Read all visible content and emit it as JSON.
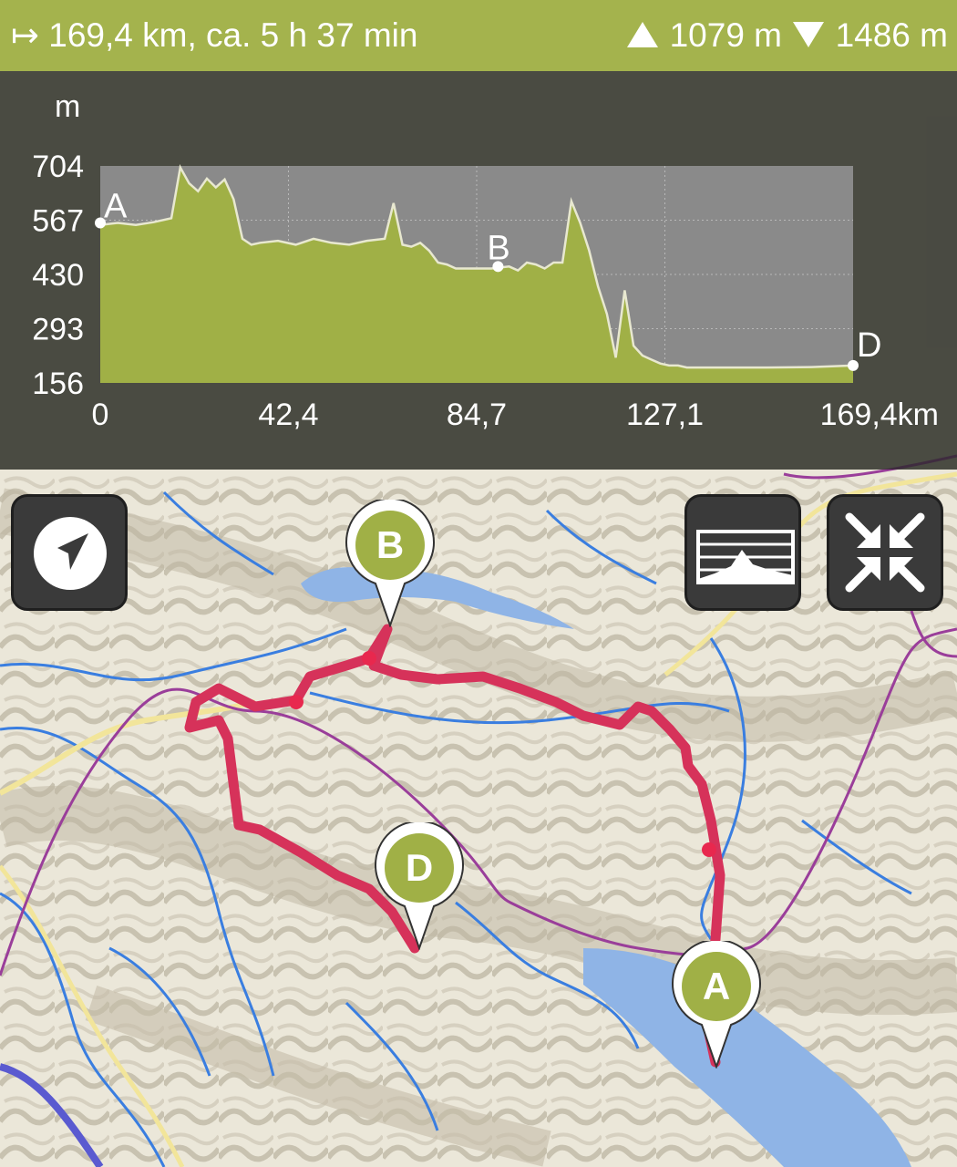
{
  "stats": {
    "distance_time": "↦ 169,4 km, ca. 5 h 37 min",
    "ascent": "1079 m",
    "descent": "1486 m"
  },
  "elevation_profile": {
    "unit": "m",
    "y_ticks": [
      "704",
      "567",
      "430",
      "293",
      "156"
    ],
    "x_ticks": [
      "0",
      "42,4",
      "84,7",
      "127,1",
      "169,4km"
    ],
    "waypoint_labels": [
      "A",
      "B",
      "D"
    ],
    "chart_data": {
      "type": "area",
      "ylim": [
        156,
        704
      ],
      "xlim": [
        0,
        169.4
      ],
      "x": [
        0,
        4,
        8,
        12,
        16,
        18,
        20,
        22,
        24,
        26,
        28,
        30,
        32,
        34,
        36,
        40,
        44,
        48,
        52,
        56,
        60,
        64,
        66,
        68,
        70,
        72,
        74,
        76,
        78,
        80,
        84,
        88,
        92,
        94,
        96,
        98,
        100,
        102,
        104,
        106,
        108,
        110,
        112,
        114,
        116,
        118,
        120,
        122,
        124,
        126,
        128,
        130,
        132,
        134,
        140,
        150,
        160,
        169.4
      ],
      "y": [
        555,
        560,
        555,
        562,
        572,
        700,
        660,
        640,
        672,
        650,
        670,
        620,
        520,
        505,
        510,
        515,
        505,
        520,
        510,
        505,
        515,
        520,
        610,
        505,
        500,
        510,
        490,
        460,
        455,
        445,
        445,
        445,
        450,
        440,
        460,
        455,
        445,
        460,
        460,
        615,
        560,
        490,
        400,
        330,
        220,
        390,
        250,
        225,
        215,
        205,
        200,
        200,
        195,
        195,
        195,
        195,
        196,
        200
      ]
    },
    "waypoints": [
      {
        "label": "A",
        "km": 0,
        "m": 560
      },
      {
        "label": "B",
        "km": 89.5,
        "m": 450
      },
      {
        "label": "D",
        "km": 169.4,
        "m": 200
      }
    ],
    "colors": {
      "fill": "#a0b046",
      "line": "#e8e8d0",
      "plot_bg": "#8a8a8a"
    }
  },
  "buttons": {
    "locate": "navigation-arrow-icon",
    "profile": "elevation-profile-icon",
    "collapse": "collapse-arrows-icon"
  },
  "markers": {
    "a": "A",
    "b": "B",
    "d": "D"
  },
  "colors": {
    "accent": "#a0b046",
    "route": "#d6325a",
    "water": "#3a7ee0",
    "boundary": "#9a3e9a"
  }
}
